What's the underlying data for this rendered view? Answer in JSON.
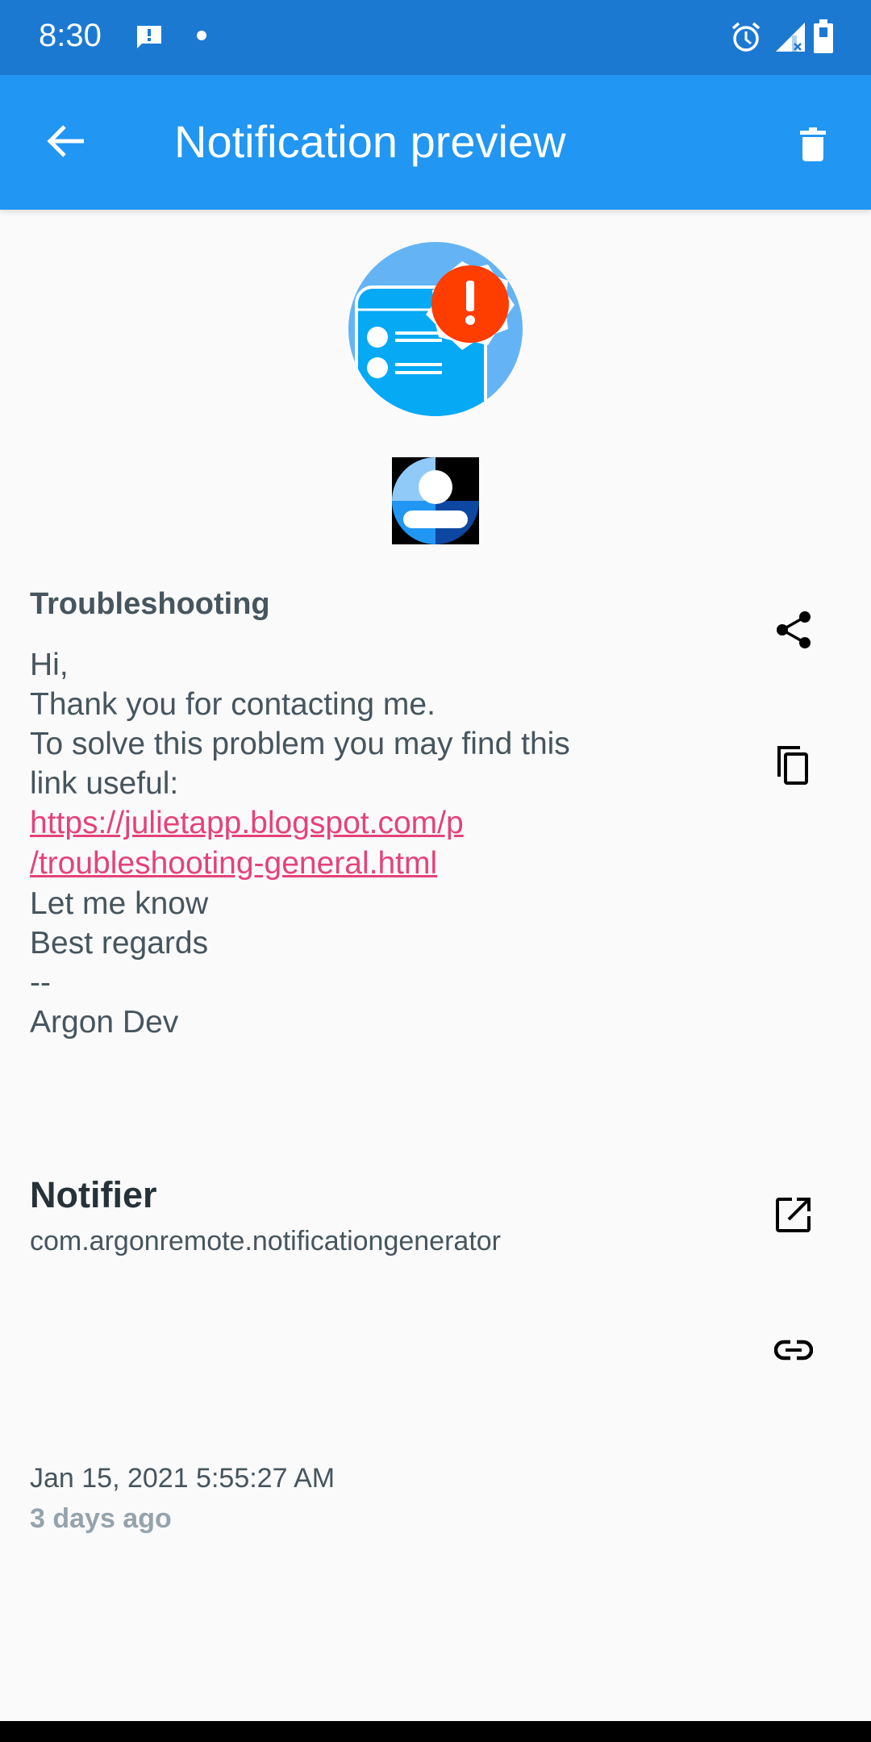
{
  "status_bar": {
    "time": "8:30",
    "left_icons": [
      "message-alert-icon",
      "dot-icon"
    ],
    "right_icons": [
      "alarm-icon",
      "signal-no-data-icon",
      "battery-icon"
    ]
  },
  "app_bar": {
    "title": "Notification preview",
    "back_icon": "arrow-left-icon",
    "delete_icon": "trash-icon",
    "background_color": "#2196f2",
    "status_color": "#1c79d2"
  },
  "notification": {
    "title": "Troubleshooting",
    "body_lines_before_link": [
      "Hi,",
      "Thank you for contacting me.",
      "To solve this problem you may find this",
      "link useful:"
    ],
    "link_lines": [
      "https://julietapp.blogspot.com/p",
      "/troubleshooting-general.html"
    ],
    "body_lines_after_link": [
      "Let me know",
      "Best regards",
      "--",
      "Argon Dev"
    ],
    "link_color": "#e5427a"
  },
  "actions": {
    "share_icon": "share-icon",
    "copy_icon": "copy-icon",
    "open_app_icon": "open-in-new-icon",
    "link_icon": "link-icon"
  },
  "app_info": {
    "name": "Notifier",
    "package": "com.argonremote.notificationgenerator"
  },
  "timestamp": {
    "date": "Jan 15, 2021 5:55:27 AM",
    "relative": "3 days ago"
  }
}
